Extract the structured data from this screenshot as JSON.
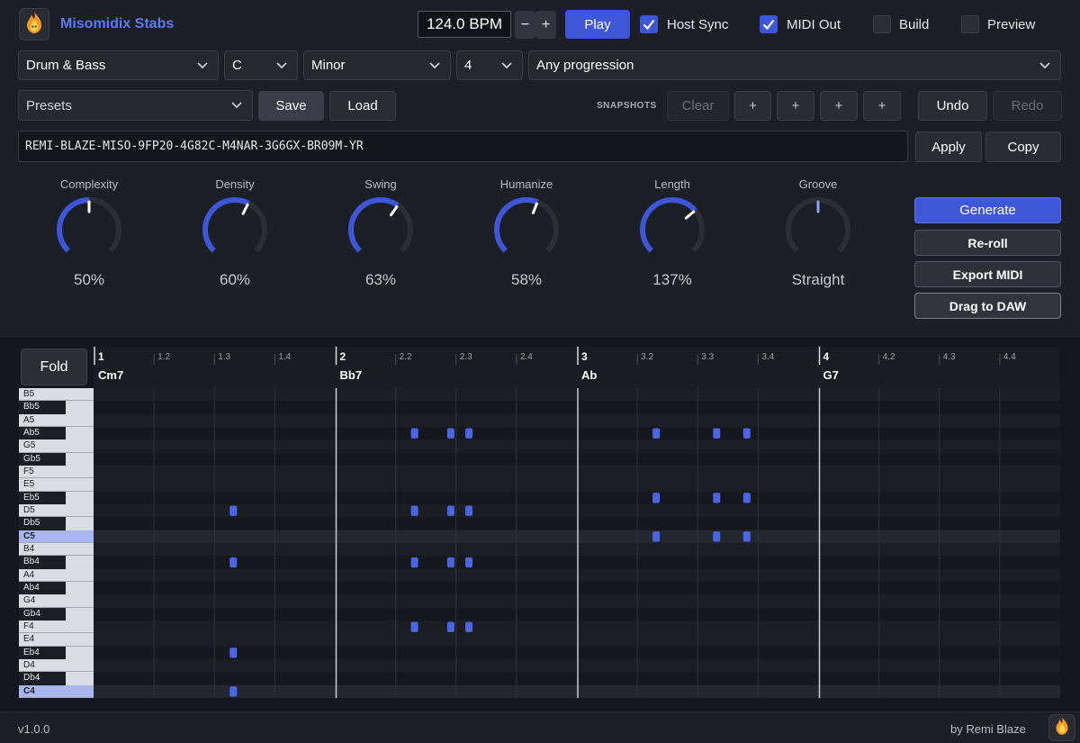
{
  "app": {
    "title": "Misomidix Stabs",
    "logo_icon": "flame-icon"
  },
  "transport": {
    "bpm": "124.0 BPM",
    "minus": "−",
    "plus": "+",
    "play": "Play",
    "checks": [
      {
        "label": "Host Sync",
        "checked": true
      },
      {
        "label": "MIDI Out",
        "checked": true
      },
      {
        "label": "Build",
        "checked": false
      },
      {
        "label": "Preview",
        "checked": false
      }
    ]
  },
  "selectors": {
    "genre": "Drum & Bass",
    "key": "C",
    "scale": "Minor",
    "bars": "4",
    "progression": "Any progression"
  },
  "presets": {
    "placeholder": "Presets",
    "save": "Save",
    "load": "Load",
    "snapshots_label": "SNAPSHOTS",
    "clear": "Clear",
    "snap_slots": [
      "+",
      "+",
      "+",
      "+"
    ],
    "undo": "Undo",
    "redo": "Redo"
  },
  "code": {
    "value": "REMI-BLAZE-MISO-9FP20-4G82C-M4NAR-3G6GX-BR09M-YR",
    "apply": "Apply",
    "copy": "Copy"
  },
  "knobs": [
    {
      "label": "Complexity",
      "value": "50%",
      "level": 0.5
    },
    {
      "label": "Density",
      "value": "60%",
      "level": 0.6
    },
    {
      "label": "Swing",
      "value": "63%",
      "level": 0.63
    },
    {
      "label": "Humanize",
      "value": "58%",
      "level": 0.58
    },
    {
      "label": "Length",
      "value": "137%",
      "level": 0.685
    },
    {
      "label": "Groove",
      "value": "Straight",
      "level": 0.5,
      "inactive": true
    }
  ],
  "actions": {
    "generate": "Generate",
    "reroll": "Re-roll",
    "export": "Export MIDI",
    "drag": "Drag to DAW"
  },
  "roll": {
    "fold": "Fold",
    "bars": [
      "1",
      "2",
      "3",
      "4"
    ],
    "beats": [
      "1.2",
      "1.3",
      "1.4",
      "2.2",
      "2.3",
      "2.4",
      "3.2",
      "3.3",
      "3.4",
      "4.2",
      "4.3",
      "4.4"
    ],
    "chords": [
      "Cm7",
      "Bb7",
      "Ab",
      "G7"
    ],
    "notes_keys": [
      "B5",
      "Bb5",
      "A5",
      "Ab5",
      "G5",
      "Gb5",
      "F5",
      "E5",
      "Eb5",
      "D5",
      "Db5",
      "C5",
      "B4",
      "Bb4",
      "A4",
      "Ab4",
      "G4",
      "Gb4",
      "F4",
      "E4",
      "Eb4",
      "D4",
      "Db4",
      "C4"
    ],
    "notes": [
      {
        "pitch": "D5",
        "beat": 1.3
      },
      {
        "pitch": "Bb4",
        "beat": 1.3
      },
      {
        "pitch": "Eb4",
        "beat": 1.3
      },
      {
        "pitch": "C4",
        "beat": 1.3
      },
      {
        "pitch": "Ab5",
        "beat": 2.2
      },
      {
        "pitch": "D5",
        "beat": 2.2
      },
      {
        "pitch": "Bb4",
        "beat": 2.2
      },
      {
        "pitch": "F4",
        "beat": 2.2
      },
      {
        "pitch": "Ab5",
        "beat": 2.26
      },
      {
        "pitch": "Ab5",
        "beat": 2.29
      },
      {
        "pitch": "D5",
        "beat": 2.26
      },
      {
        "pitch": "D5",
        "beat": 2.29
      },
      {
        "pitch": "Bb4",
        "beat": 2.26
      },
      {
        "pitch": "Bb4",
        "beat": 2.29
      },
      {
        "pitch": "F4",
        "beat": 2.26
      },
      {
        "pitch": "F4",
        "beat": 2.29
      },
      {
        "pitch": "Ab5",
        "beat": 3.2
      },
      {
        "pitch": "Eb5",
        "beat": 3.2
      },
      {
        "pitch": "C5",
        "beat": 3.2
      },
      {
        "pitch": "Ab5",
        "beat": 3.3
      },
      {
        "pitch": "Eb5",
        "beat": 3.3
      },
      {
        "pitch": "C5",
        "beat": 3.3
      },
      {
        "pitch": "Ab5",
        "beat": 3.35
      },
      {
        "pitch": "Eb5",
        "beat": 3.35
      },
      {
        "pitch": "C5",
        "beat": 3.35
      }
    ],
    "note_color": "#4a66e6"
  },
  "footer": {
    "version": "v1.0.0",
    "byline": "by Remi Blaze"
  },
  "colors": {
    "accent": "#3e57d8",
    "bg": "#16171d",
    "panel": "#1d1f26"
  }
}
